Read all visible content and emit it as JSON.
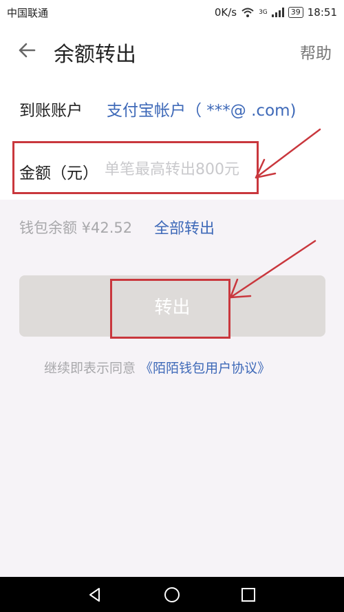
{
  "status_bar": {
    "carrier": "中国联通",
    "net_speed": "0K/s",
    "network_type": "3G",
    "battery": "39",
    "time": "18:51"
  },
  "header": {
    "title": "余额转出",
    "help": "帮助"
  },
  "account_row": {
    "label": "到账账户",
    "value": "支付宝帐户（  ***@    .com)"
  },
  "amount_row": {
    "label": "金额（元）",
    "placeholder": "单笔最高转出800元",
    "value": ""
  },
  "balance": {
    "text": "钱包余额 ¥42.52",
    "transfer_all": "全部转出"
  },
  "submit": {
    "label": "转出"
  },
  "agreement": {
    "prefix": "继续即表示同意",
    "link": "《陌陌钱包用户协议》"
  },
  "colors": {
    "accent_blue": "#3e69b8",
    "annotation_red": "#c9373d",
    "button_disabled": "#dedbd9",
    "muted_text": "#a8a8ab"
  },
  "icons": [
    "back-arrow-icon",
    "wifi-icon",
    "signal-icon",
    "battery-icon",
    "nav-back-icon",
    "nav-home-icon",
    "nav-recent-icon"
  ]
}
